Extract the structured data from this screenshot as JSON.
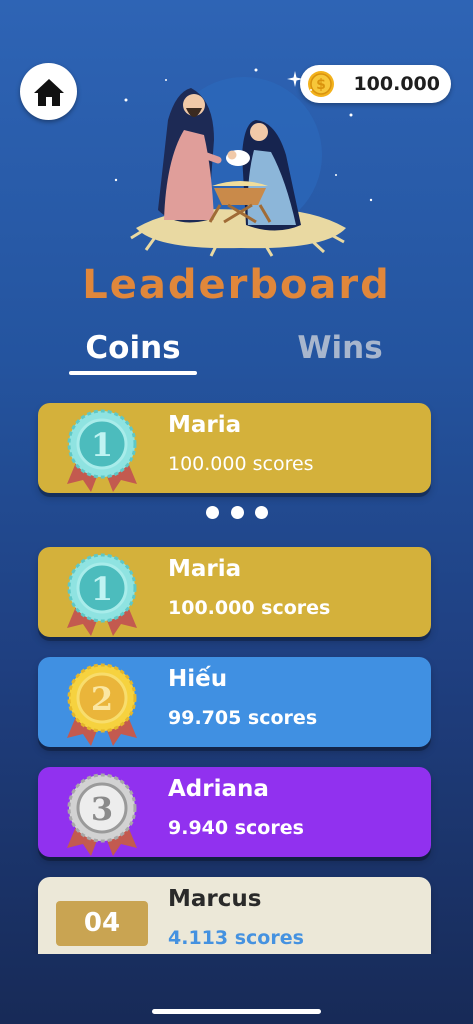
{
  "header": {
    "coins": "100.000"
  },
  "title": "Leaderboard",
  "tabs": [
    {
      "label": "Coins",
      "active": true
    },
    {
      "label": "Wins",
      "active": false
    }
  ],
  "current_user": {
    "rank": "1",
    "name": "Maria",
    "score": "100.000 scores",
    "color": "#d4b13b"
  },
  "leaderboard": [
    {
      "rank": "1",
      "name": "Maria",
      "score": "100.000 scores",
      "color": "#d4b13b",
      "medal": "gold-teal"
    },
    {
      "rank": "2",
      "name": "Hiếu",
      "score": "99.705 scores",
      "color": "#4090e2",
      "medal": "gold"
    },
    {
      "rank": "3",
      "name": "Adriana",
      "score": "9.940 scores",
      "color": "#9131ef",
      "medal": "silver"
    },
    {
      "rank": "04",
      "name": "Marcus",
      "score": "4.113 scores",
      "color": "#ece8d8"
    }
  ],
  "colors": {
    "accent_title": "#e0873b",
    "score_blue": "#4592e0"
  }
}
